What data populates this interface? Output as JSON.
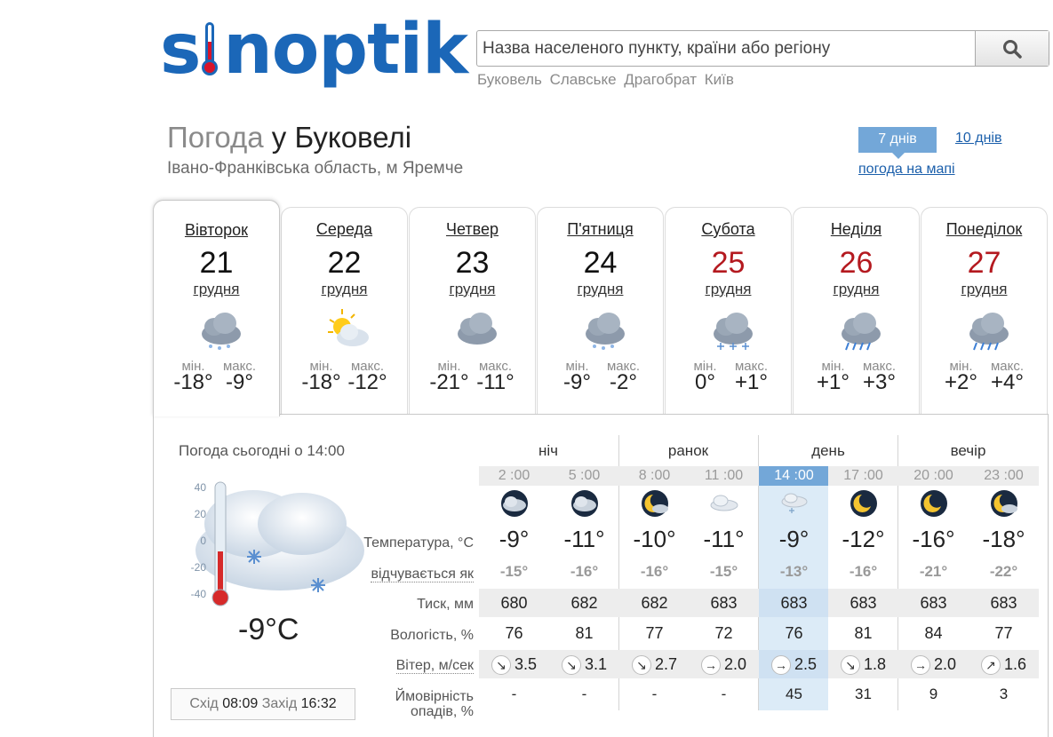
{
  "logo": {
    "text": "sinoptik"
  },
  "search": {
    "placeholder": "Назва населеного пункту, країни або регіону",
    "quick_links": [
      "Буковель",
      "Славське",
      "Драгобрат",
      "Київ"
    ]
  },
  "title": {
    "prefix": "Погода",
    "rest": "у Буковелі",
    "subtitle": "Івано-Франківська область, м Яремче"
  },
  "range_tabs": {
    "seven": "7 днів",
    "ten": "10 днів",
    "map": "погода на мапі"
  },
  "days": [
    {
      "name": "Вівторок",
      "num": "21",
      "month": "грудня",
      "min_label": "мін.",
      "max_label": "макс.",
      "min": "-18°",
      "max": "-9°",
      "weekend": false,
      "icon": "cloudy-snow-icon"
    },
    {
      "name": "Середа",
      "num": "22",
      "month": "грудня",
      "min_label": "мін.",
      "max_label": "макс.",
      "min": "-18°",
      "max": "-12°",
      "weekend": false,
      "icon": "partly-cloudy-icon"
    },
    {
      "name": "Четвер",
      "num": "23",
      "month": "грудня",
      "min_label": "мін.",
      "max_label": "макс.",
      "min": "-21°",
      "max": "-11°",
      "weekend": false,
      "icon": "cloudy-icon"
    },
    {
      "name": "П'ятниця",
      "num": "24",
      "month": "грудня",
      "min_label": "мін.",
      "max_label": "макс.",
      "min": "-9°",
      "max": "-2°",
      "weekend": false,
      "icon": "cloudy-snow-icon"
    },
    {
      "name": "Субота",
      "num": "25",
      "month": "грудня",
      "min_label": "мін.",
      "max_label": "макс.",
      "min": "0°",
      "max": "+1°",
      "weekend": true,
      "icon": "heavy-snow-icon"
    },
    {
      "name": "Неділя",
      "num": "26",
      "month": "грудня",
      "min_label": "мін.",
      "max_label": "макс.",
      "min": "+1°",
      "max": "+3°",
      "weekend": true,
      "icon": "rain-icon"
    },
    {
      "name": "Понеділок",
      "num": "27",
      "month": "грудня",
      "min_label": "мін.",
      "max_label": "макс.",
      "min": "+2°",
      "max": "+4°",
      "weekend": true,
      "icon": "rain-icon"
    }
  ],
  "today": {
    "title": "Погода сьогодні о 14:00",
    "temp": "-9°C",
    "scale": [
      "40",
      "20",
      "0",
      "-20",
      "-40"
    ],
    "sunrise_label": "Схід",
    "sunrise": "08:09",
    "sunset_label": "Захід",
    "sunset": "16:32"
  },
  "row_labels": {
    "temp": "Температура, °С",
    "feel": "відчувається як",
    "pressure": "Тиск, мм",
    "humidity": "Вологість, %",
    "wind": "Вітер, м/сек",
    "rain1": "Ймовірність",
    "rain2": "опадів, %"
  },
  "periods": [
    "ніч",
    "ранок",
    "день",
    "вечір"
  ],
  "hours": [
    {
      "time": "2 :00",
      "temp": "-9°",
      "feel": "-15°",
      "pressure": "680",
      "humidity": "76",
      "wind_dir": "↘",
      "wind": "3.5",
      "rain": "-",
      "icon": "night-cloudy-icon"
    },
    {
      "time": "5 :00",
      "temp": "-11°",
      "feel": "-16°",
      "pressure": "682",
      "humidity": "81",
      "wind_dir": "↘",
      "wind": "3.1",
      "rain": "-",
      "icon": "night-cloudy-icon"
    },
    {
      "time": "8 :00",
      "temp": "-10°",
      "feel": "-16°",
      "pressure": "682",
      "humidity": "77",
      "wind_dir": "↘",
      "wind": "2.7",
      "rain": "-",
      "icon": "moon-cloud-icon"
    },
    {
      "time": "11 :00",
      "temp": "-11°",
      "feel": "-15°",
      "pressure": "683",
      "humidity": "72",
      "wind_dir": "→",
      "wind": "2.0",
      "rain": "-",
      "icon": "cloud-icon"
    },
    {
      "time": "14 :00",
      "temp": "-9°",
      "feel": "-13°",
      "pressure": "683",
      "humidity": "76",
      "wind_dir": "→",
      "wind": "2.5",
      "rain": "45",
      "icon": "cloud-snow-icon"
    },
    {
      "time": "17 :00",
      "temp": "-12°",
      "feel": "-16°",
      "pressure": "683",
      "humidity": "81",
      "wind_dir": "↘",
      "wind": "1.8",
      "rain": "31",
      "icon": "moon-icon"
    },
    {
      "time": "20 :00",
      "temp": "-16°",
      "feel": "-21°",
      "pressure": "683",
      "humidity": "84",
      "wind_dir": "→",
      "wind": "2.0",
      "rain": "9",
      "icon": "moon-icon"
    },
    {
      "time": "23 :00",
      "temp": "-18°",
      "feel": "-22°",
      "pressure": "683",
      "humidity": "77",
      "wind_dir": "↗",
      "wind": "1.6",
      "rain": "3",
      "icon": "moon-cloud-icon"
    }
  ],
  "current_hour_index": 4,
  "colors": {
    "brand": "#1b67b8",
    "accent": "#73a7d8",
    "weekend": "#b4191f",
    "highlight": "#dcebf7"
  }
}
